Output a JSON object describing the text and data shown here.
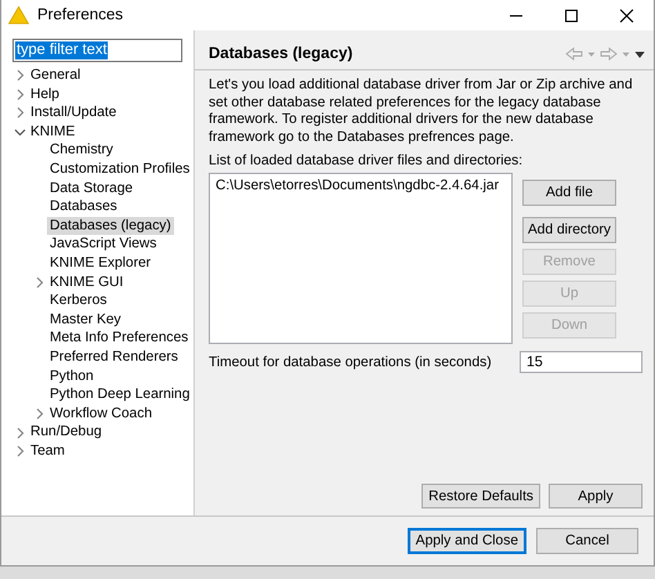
{
  "window": {
    "title": "Preferences"
  },
  "filter": {
    "value": "type filter text",
    "selected": true
  },
  "tree": [
    {
      "label": "General",
      "kind": "branch",
      "expanded": false,
      "selected": false
    },
    {
      "label": "Help",
      "kind": "branch",
      "expanded": false,
      "selected": false
    },
    {
      "label": "Install/Update",
      "kind": "branch",
      "expanded": false,
      "selected": false
    },
    {
      "label": "KNIME",
      "kind": "branch",
      "expanded": true,
      "selected": false,
      "children": [
        {
          "label": "Chemistry",
          "kind": "leaf",
          "selected": false
        },
        {
          "label": "Customization Profiles",
          "kind": "leaf",
          "selected": false
        },
        {
          "label": "Data Storage",
          "kind": "leaf",
          "selected": false
        },
        {
          "label": "Databases",
          "kind": "leaf",
          "selected": false
        },
        {
          "label": "Databases (legacy)",
          "kind": "leaf",
          "selected": true
        },
        {
          "label": "JavaScript Views",
          "kind": "leaf",
          "selected": false
        },
        {
          "label": "KNIME Explorer",
          "kind": "leaf",
          "selected": false
        },
        {
          "label": "KNIME GUI",
          "kind": "branch",
          "expanded": false,
          "selected": false
        },
        {
          "label": "Kerberos",
          "kind": "leaf",
          "selected": false
        },
        {
          "label": "Master Key",
          "kind": "leaf",
          "selected": false
        },
        {
          "label": "Meta Info Preferences",
          "kind": "leaf",
          "selected": false
        },
        {
          "label": "Preferred Renderers",
          "kind": "leaf",
          "selected": false
        },
        {
          "label": "Python",
          "kind": "leaf",
          "selected": false
        },
        {
          "label": "Python Deep Learning",
          "kind": "leaf",
          "selected": false
        },
        {
          "label": "Workflow Coach",
          "kind": "branch",
          "expanded": false,
          "selected": false
        }
      ]
    },
    {
      "label": "Run/Debug",
      "kind": "branch",
      "expanded": false,
      "selected": false
    },
    {
      "label": "Team",
      "kind": "branch",
      "expanded": false,
      "selected": false
    }
  ],
  "page": {
    "title": "Databases (legacy)",
    "description": "Let's you load additional database driver from Jar or Zip archive and set other database related preferences for the legacy database framework. To register additional drivers for the new database framework go to the Databases prefrences page.",
    "list_label": "List of loaded database driver files and directories:",
    "files": [
      "C:\\Users\\etorres\\Documents\\ngdbc-2.4.64.jar"
    ],
    "list_buttons": [
      {
        "label": "Add file",
        "disabled": false
      },
      {
        "label": "Add directory",
        "disabled": false
      },
      {
        "label": "Remove",
        "disabled": true
      },
      {
        "label": "Up",
        "disabled": true
      },
      {
        "label": "Down",
        "disabled": true
      }
    ],
    "timeout_label": "Timeout for database operations (in seconds)",
    "timeout_value": "15",
    "page_buttons": [
      {
        "label": "Restore Defaults",
        "default": false
      },
      {
        "label": "Apply",
        "default": false
      }
    ]
  },
  "dialog_buttons": [
    {
      "label": "Apply and Close",
      "default": true
    },
    {
      "label": "Cancel",
      "default": false
    }
  ]
}
